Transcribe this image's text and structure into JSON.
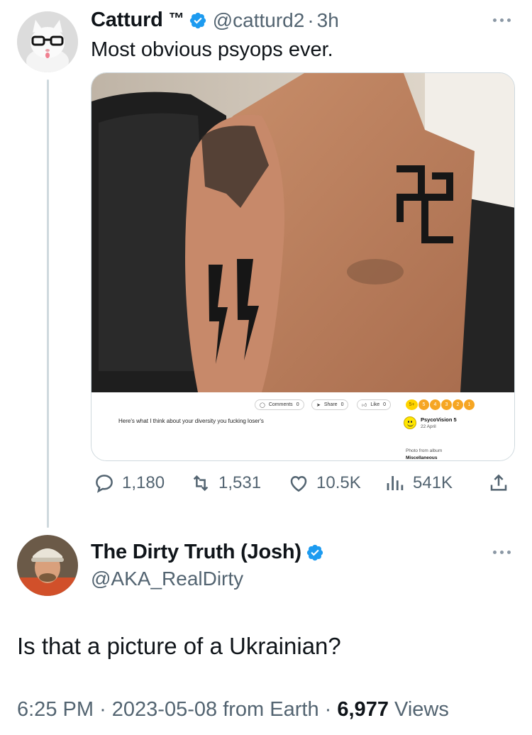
{
  "tweet1": {
    "name": "Catturd",
    "tm": "™",
    "handle": "@catturd2",
    "dot": "·",
    "age": "3h",
    "text": "Most obvious psyops ever.",
    "media": {
      "buttons": [
        {
          "label": "Comments",
          "count": "0"
        },
        {
          "label": "Share",
          "count": "0"
        },
        {
          "label": "Like",
          "count": "0"
        }
      ],
      "rating_label": "5+",
      "rating_values": [
        "5",
        "4",
        "3",
        "2",
        "1"
      ],
      "caption": "Here's what I think about your diversity you fucking loser's",
      "user": "PsycoVision 5",
      "date": "22 April",
      "album_label": "Photo from album",
      "album_name": "Miscellaneous"
    },
    "stats": {
      "replies": "1,180",
      "retweets": "1,531",
      "likes": "10.5K",
      "views": "541K"
    }
  },
  "tweet2": {
    "name": "The Dirty Truth (Josh)",
    "handle": "@AKA_RealDirty",
    "text": "Is that a picture of a Ukrainian?",
    "time": "6:25 PM",
    "date": "2023-05-08",
    "source": "from Earth",
    "views_count": "6,977",
    "views_label": "Views"
  },
  "colors": {
    "verified": "#1d9bf0",
    "secondary_text": "#536471",
    "thread_line": "#cfd9de"
  }
}
